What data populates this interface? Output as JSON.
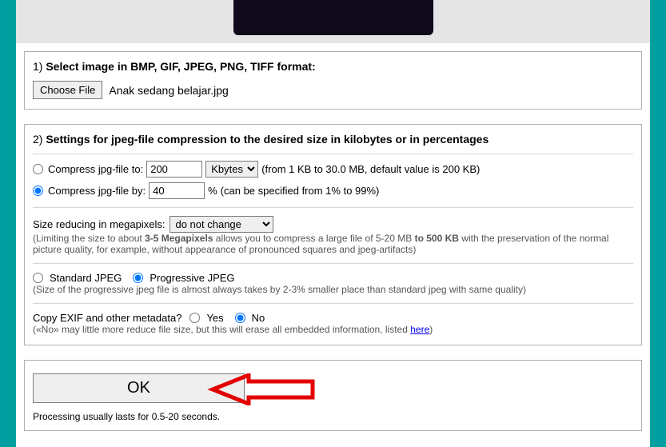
{
  "section1": {
    "num": "1)",
    "title": "Select image in BMP, GIF, JPEG, PNG, TIFF format:",
    "choose_file_label": "Choose File",
    "filename": "Anak sedang belajar.jpg"
  },
  "section2": {
    "num": "2)",
    "title": "Settings for jpeg-file compression to the desired size in kilobytes or in percentages",
    "compress_to_label": "Compress jpg-file to:",
    "compress_to_value": "200",
    "compress_to_unit": "Kbytes",
    "compress_to_hint": "(from 1 KB to 30.0 MB, default value is 200 KB)",
    "compress_by_label": "Compress jpg-file by:",
    "compress_by_value": "40",
    "compress_by_pct": "%",
    "compress_by_hint": "(can be specified from 1% to 99%)",
    "resize_label": "Size reducing in megapixels:",
    "resize_value": "do not change",
    "resize_note_pre": "(Limiting the size to about ",
    "resize_note_bold1": "3-5 Megapixels",
    "resize_note_mid": " allows you to compress a large file of 5-20 MB ",
    "resize_note_bold2": "to 500 KB",
    "resize_note_post": " with the preservation of the normal picture quality, for example, without appearance of pronounced squares and jpeg-artifacts)",
    "jpeg_type_standard": "Standard JPEG",
    "jpeg_type_progressive": "Progressive JPEG",
    "jpeg_type_note": "(Size of the progressive jpeg file is almost always takes by 2-3% smaller place than standard jpeg with same quality)",
    "exif_label": "Copy EXIF and other metadata?",
    "exif_yes": "Yes",
    "exif_no": "No",
    "exif_note_pre": "(«No» may little more reduce file size, but this will erase all embedded information, listed ",
    "exif_note_link": "here",
    "exif_note_post": ")"
  },
  "submit": {
    "ok_label": "OK",
    "processing_note": "Processing usually lasts for 0.5-20 seconds."
  }
}
